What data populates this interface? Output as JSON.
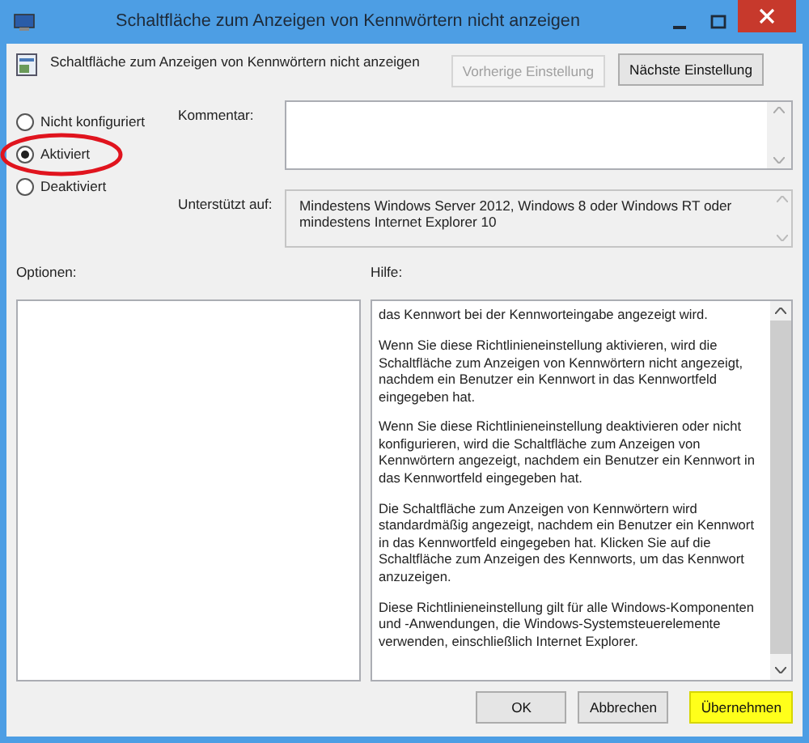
{
  "window": {
    "title": "Schaltfläche zum Anzeigen von Kennwörtern nicht anzeigen"
  },
  "policy_name": "Schaltfläche zum Anzeigen von Kennwörtern nicht anzeigen",
  "nav_buttons": [
    {
      "label": "Vorherige Einstellung",
      "disabled": true
    },
    {
      "label": "Nächste Einstellung",
      "disabled": false
    }
  ],
  "options": [
    {
      "label": "Nicht konfiguriert",
      "selected": false,
      "circled": false
    },
    {
      "label": "Aktiviert",
      "selected": true,
      "circled": true
    },
    {
      "label": "Deaktiviert",
      "selected": false,
      "circled": false
    }
  ],
  "comment": {
    "label": "Kommentar:"
  },
  "supported": {
    "label": "Unterstützt auf:",
    "value": "Mindestens Windows Server 2012, Windows 8 oder Windows RT oder mindestens Internet Explorer 10"
  },
  "options_label": "Optionen:",
  "help_label": "Hilfe:",
  "help_paragraphs": [
    "das Kennwort bei der Kennworteingabe angezeigt wird.",
    "Wenn Sie diese Richtlinieneinstellung aktivieren, wird die Schaltfläche zum Anzeigen von Kennwörtern nicht angezeigt, nachdem ein Benutzer ein Kennwort in das Kennwortfeld eingegeben hat.",
    "Wenn Sie diese Richtlinieneinstellung deaktivieren oder nicht konfigurieren, wird die Schaltfläche zum Anzeigen von Kennwörtern angezeigt, nachdem ein Benutzer ein Kennwort in das Kennwortfeld eingegeben hat.",
    "Die Schaltfläche zum Anzeigen von Kennwörtern wird standardmäßig angezeigt, nachdem ein Benutzer ein Kennwort in das Kennwortfeld eingegeben hat. Klicken Sie auf die Schaltfläche zum Anzeigen des Kennworts, um das Kennwort anzuzeigen.",
    "Diese Richtlinieneinstellung gilt für alle Windows-Komponenten und -Anwendungen, die Windows-Systemsteuerelemente verwenden, einschließlich Internet Explorer."
  ],
  "buttons": [
    {
      "label": "OK",
      "highlighted": false
    },
    {
      "label": "Abbrechen",
      "highlighted": false
    },
    {
      "label": "Übernehmen",
      "highlighted": true
    }
  ]
}
